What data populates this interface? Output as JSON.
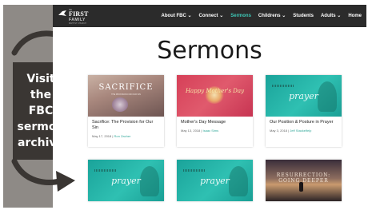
{
  "promo": {
    "lines": [
      "Visit",
      "the",
      "FBC",
      "sermon",
      "archive"
    ]
  },
  "site": {
    "logo": {
      "small": "the",
      "first": "FIRST",
      "family": "FAMILY",
      "tag": "BAPTIST CHURCH"
    },
    "nav": [
      {
        "label": "About FBC ⌄",
        "active": false
      },
      {
        "label": "Connect ⌄",
        "active": false
      },
      {
        "label": "Sermons",
        "active": true
      },
      {
        "label": "Childrens ⌄",
        "active": false
      },
      {
        "label": "Students",
        "active": false
      },
      {
        "label": "Adults ⌄",
        "active": false
      },
      {
        "label": "Home",
        "active": false
      }
    ],
    "page_title": "Sermons",
    "cards": [
      {
        "thumb_text": "SACRIFICE",
        "thumb_sub": "THE PROVISION FOR OUR SIN",
        "title": "Sacrifice: The Provision for Our Sin",
        "date": "May 17, 2018 |",
        "author": "Ron Zacher"
      },
      {
        "thumb_text": "Happy Mother's Day",
        "title": "Mother's Day Message",
        "date": "May 13, 2018 |",
        "author": "Isaac Sims"
      },
      {
        "thumb_text": "prayer",
        "title": "Our Position & Posture in Prayer",
        "date": "May 3, 2018 |",
        "author": "Jeff Stackelfelp"
      },
      {
        "thumb_text": "prayer"
      },
      {
        "thumb_text": "prayer"
      },
      {
        "thumb_text": "RESURRECTION: GOING DEEPER"
      }
    ]
  },
  "colors": {
    "accent_teal": "#3ec9b8",
    "navbar": "#2b2b2b",
    "promo_box": "#3a3633",
    "side_panel": "#8e8a86"
  }
}
